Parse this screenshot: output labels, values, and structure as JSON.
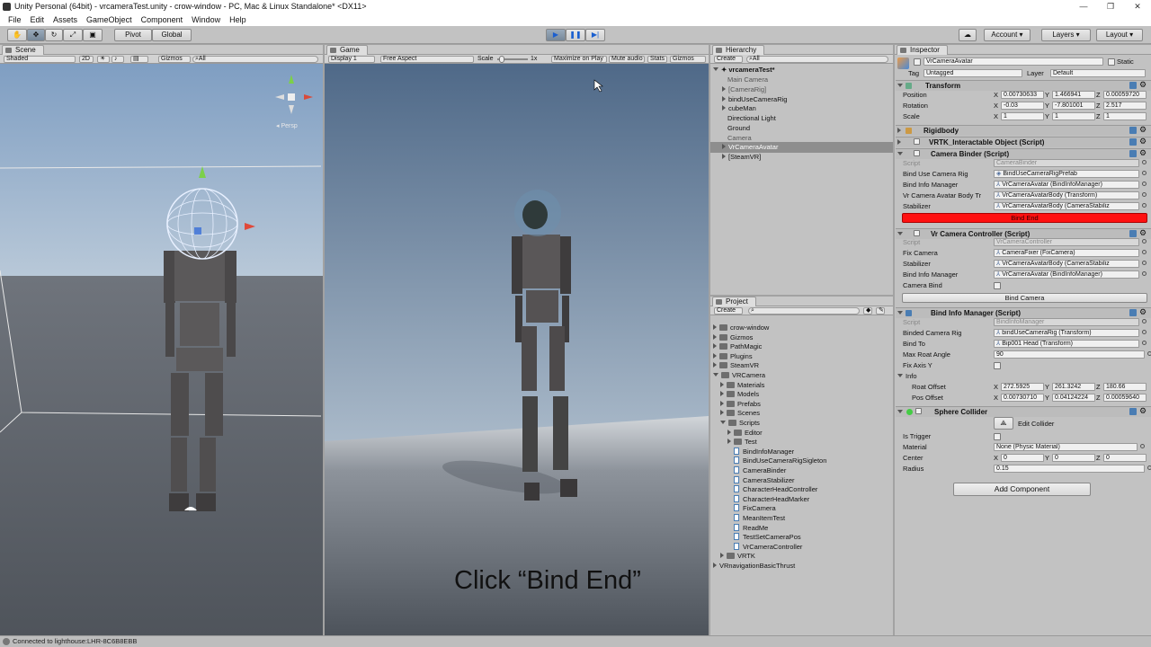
{
  "title": "Unity Personal (64bit) - vrcameraTest.unity - crow-window - PC, Mac & Linux Standalone* <DX11>",
  "window_controls": [
    "—",
    "❐",
    "✕"
  ],
  "menu": [
    "File",
    "Edit",
    "Assets",
    "GameObject",
    "Component",
    "Window",
    "Help"
  ],
  "toolbar": {
    "pivot": "Pivot",
    "global": "Global",
    "account": "Account",
    "layers": "Layers",
    "layout": "Layout"
  },
  "scene": {
    "tab": "Scene",
    "shaded": "Shaded",
    "mode2d": "2D",
    "gizmos": "Gizmos",
    "search": "All",
    "persp": "Persp"
  },
  "game": {
    "tab": "Game",
    "display": "Display 1",
    "aspect": "Free Aspect",
    "scale_label": "Scale",
    "scale_value": "1x",
    "maximize": "Maximize on Play",
    "mute": "Mute audio",
    "stats": "Stats",
    "gizmos": "Gizmos",
    "caption": "Click “Bind End”"
  },
  "hierarchy": {
    "tab": "Hierarchy",
    "create": "Create",
    "search": "All",
    "root": "vrcameraTest*",
    "items": [
      "Main Camera",
      "[CameraRig]",
      "bindUseCameraRig",
      "cubeMan",
      "Directional Light",
      "Ground",
      "Camera",
      "VrCameraAvatar",
      "[SteamVR]"
    ]
  },
  "project": {
    "tab": "Project",
    "create": "Create",
    "items": [
      "crow-window",
      "Gizmos",
      "PathMagic",
      "Plugins",
      "SteamVR",
      "VRCamera",
      "Materials",
      "Models",
      "Prefabs",
      "Scenes",
      "Scripts",
      "Editor",
      "Test",
      "BindInfoManager",
      "BindUseCameraRigSigleton",
      "CameraBinder",
      "CameraStabilizer",
      "CharacterHeadController",
      "CharacterHeadMarker",
      "FixCamera",
      "MeanItemTest",
      "ReadMe",
      "TestSetCameraPos",
      "VrCameraController",
      "VRTK",
      "VRnavigationBasicThrust"
    ]
  },
  "inspector": {
    "tab": "Inspector",
    "object_name": "VrCameraAvatar",
    "static": "Static",
    "tag_label": "Tag",
    "tag": "Untagged",
    "layer_label": "Layer",
    "layer": "Default",
    "transform": {
      "title": "Transform",
      "position_label": "Position",
      "rotation_label": "Rotation",
      "scale_label": "Scale",
      "position": [
        "0.00730633",
        "1.466941",
        "0.00059720"
      ],
      "rotation": [
        "-0.03",
        "-7.801001",
        "2.517"
      ],
      "scale": [
        "1",
        "1",
        "1"
      ]
    },
    "rigidbody": "Rigidbody",
    "vrtk": "VRTK_Interactable Object (Script)",
    "camera_binder": {
      "title": "Camera Binder (Script)",
      "script_label": "Script",
      "script": "CameraBinder",
      "bind_rig_label": "Bind Use Camera Rig",
      "bind_rig": "BindUseCameraRigPrefab",
      "bind_info_label": "Bind Info Manager",
      "bind_info": "VrCameraAvatar (BindInfoManager)",
      "body_label": "Vr Camera Avatar Body Tr",
      "body": "VrCameraAvatarBody (Transform)",
      "stabilizer_label": "Stabilizer",
      "stabilizer": "VrCameraAvatarBody (CameraStabiliz",
      "bind_end": "Bind End"
    },
    "camera_controller": {
      "title": "Vr Camera Controller (Script)",
      "script_label": "Script",
      "script": "VrCameraController",
      "fix_label": "Fix Camera",
      "fix": "CameraFixer (FixCamera)",
      "stabilizer_label": "Stabilizer",
      "stabilizer": "VrCameraAvatarBody (CameraStabiliz",
      "bind_info_label": "Bind Info Manager",
      "bind_info": "VrCameraAvatar (BindInfoManager)",
      "camera_bind_label": "Camera Bind",
      "bind_camera": "Bind Camera"
    },
    "bind_info_manager": {
      "title": "Bind Info Manager (Script)",
      "script_label": "Script",
      "script": "BindInfoManager",
      "rig_label": "Binded Camera Rig",
      "rig": "bindUseCameraRig (Transform)",
      "to_label": "Bind To",
      "to": "Bip001 Head (Transform)",
      "max_label": "Max Roat Angle",
      "max": "90",
      "fix_axis_label": "Fix Axis Y",
      "info_label": "Info",
      "roat_label": "Roat Offset",
      "roat": [
        "272.5925",
        "261.3242",
        "180.66"
      ],
      "pos_label": "Pos Offset",
      "pos": [
        "0.00730710",
        "0.04124224",
        "0.00059640"
      ]
    },
    "sphere_collider": {
      "title": "Sphere Collider",
      "edit": "Edit Collider",
      "trigger_label": "Is Trigger",
      "material_label": "Material",
      "material": "None (Physic Material)",
      "center_label": "Center",
      "center": [
        "0",
        "0",
        "0"
      ],
      "radius_label": "Radius",
      "radius": "0.15"
    },
    "add_component": "Add Component"
  },
  "status": "Connected to lighthouse:LHR-8C6B8EBB",
  "colors": {
    "bind_end": "#ff1010",
    "selection": "#8e8e8e",
    "sky": "#9cb3cc"
  }
}
